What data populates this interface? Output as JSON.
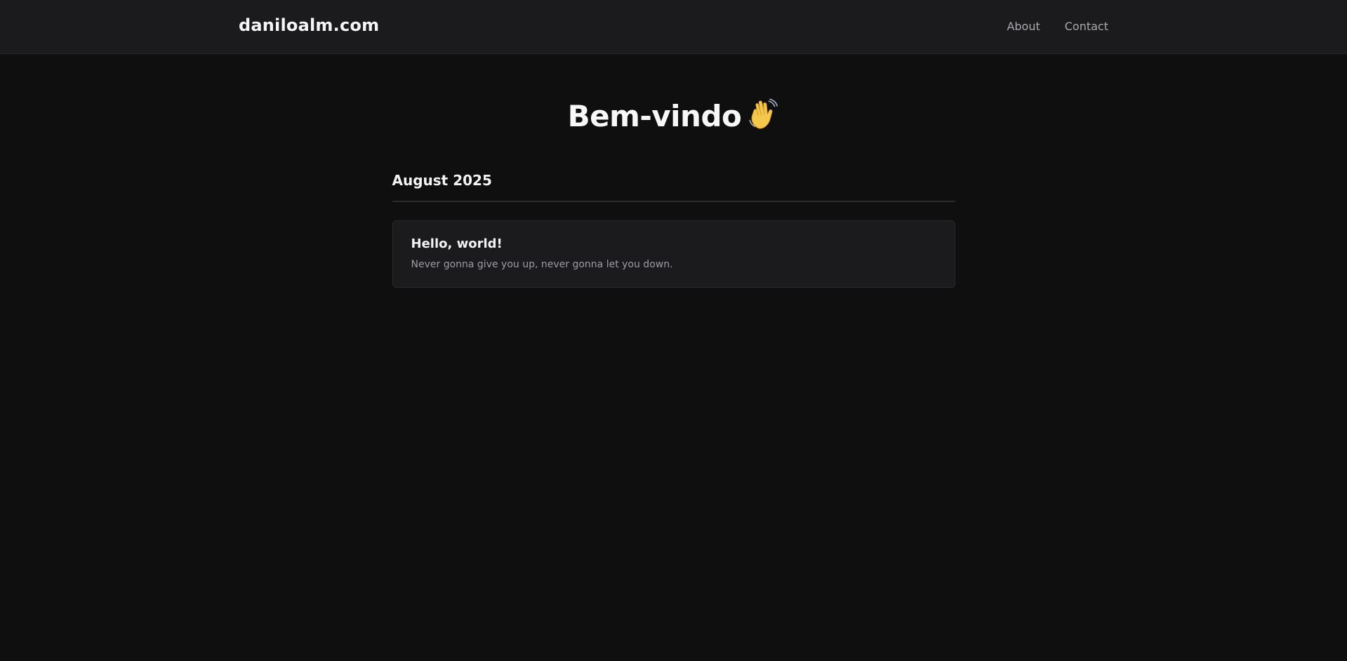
{
  "header": {
    "brand": "daniloalm.com",
    "nav": [
      {
        "label": "About"
      },
      {
        "label": "Contact"
      }
    ]
  },
  "hero": {
    "title": "Bem-vindo",
    "emoji_icon": "waving-hand-icon"
  },
  "archive": [
    {
      "month": "August 2025",
      "posts": [
        {
          "title": "Hello, world!",
          "excerpt": "Never gonna give you up, never gonna let you down."
        }
      ]
    }
  ],
  "colors": {
    "background": "#0f0f10",
    "header_bg": "#1b1b1d",
    "card_bg": "#1b1b1d",
    "text": "#f2f2f2",
    "muted_text": "#9c9ca2",
    "emoji": "#f5c84c"
  }
}
